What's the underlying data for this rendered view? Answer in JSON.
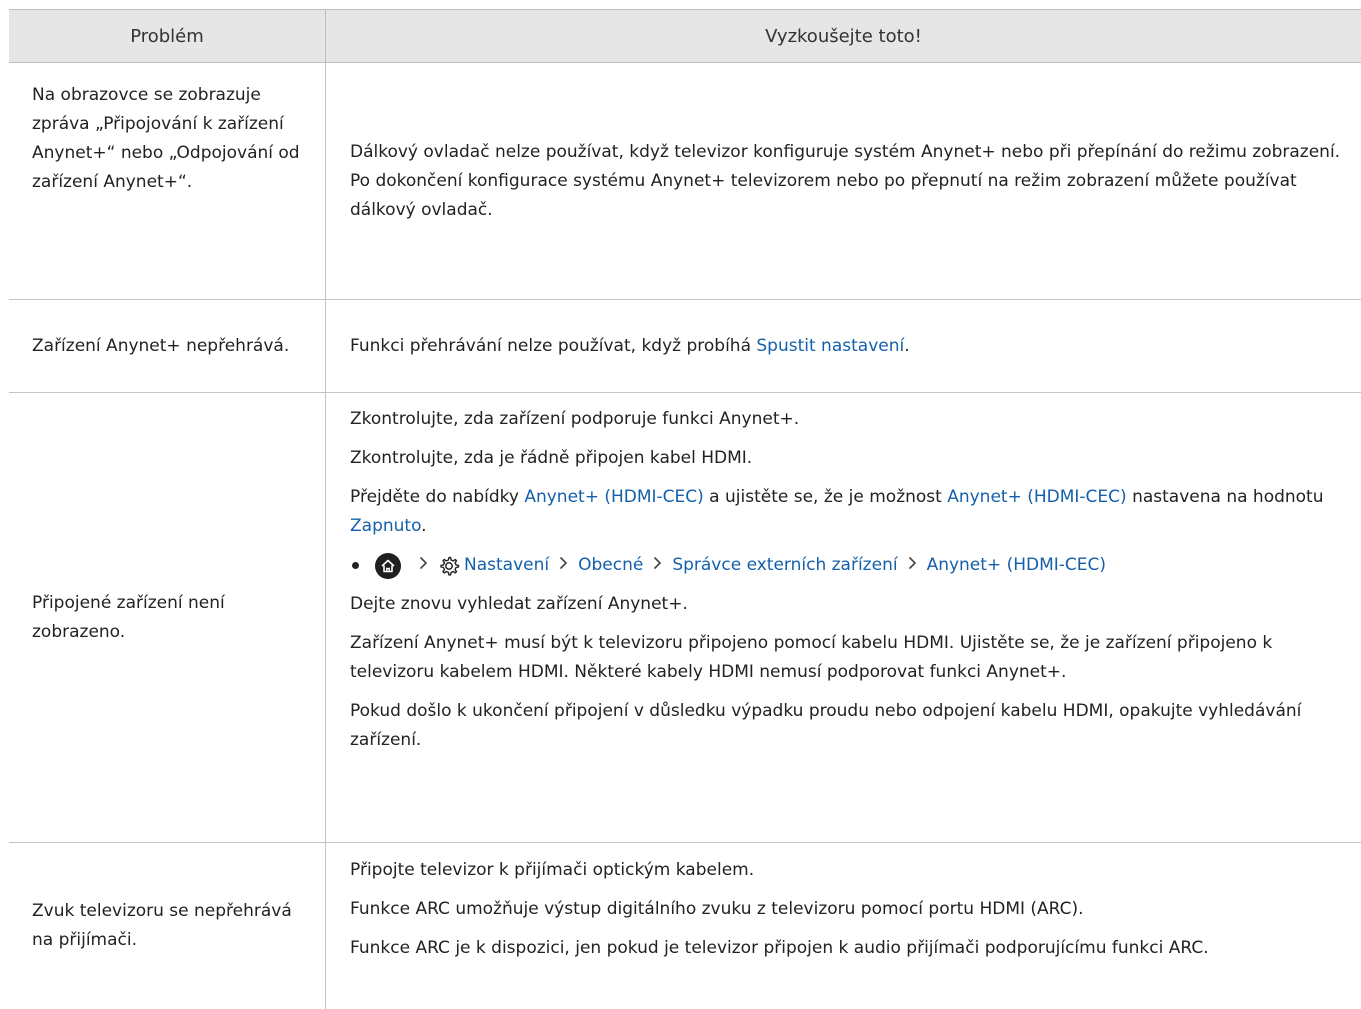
{
  "header": {
    "col_problem": "Problém",
    "col_solution": "Vyzkoušejte toto!"
  },
  "rows": [
    {
      "problem": "Na obrazovce se zobrazuje zpráva „Připojování k zařízení Anynet+“ nebo „Odpojování od zařízení Anynet+“.",
      "solution": "Dálkový ovladač nelze používat, když televizor konfiguruje systém Anynet+ nebo při přepínání do režimu zobrazení. Po dokončení konfigurace systému Anynet+ televizorem nebo po přepnutí na režim zobrazení můžete používat dálkový ovladač."
    },
    {
      "problem": "Zařízení Anynet+ nepřehrává.",
      "solution_pre": "Funkci přehrávání nelze používat, když probíhá ",
      "solution_link": "Spustit nastavení",
      "solution_post": "."
    },
    {
      "problem": "Připojené zařízení není zobrazeno.",
      "p1": "Zkontrolujte, zda zařízení podporuje funkci Anynet+.",
      "p2": "Zkontrolujte, zda je řádně připojen kabel HDMI.",
      "p3_a": "Přejděte do nabídky ",
      "p3_link1": "Anynet+ (HDMI-CEC)",
      "p3_b": " a ujistěte se, že je možnost ",
      "p3_link2": "Anynet+ (HDMI-CEC)",
      "p3_c": " nastavena na hodnotu ",
      "p3_link3": "Zapnuto",
      "p3_d": ".",
      "path": [
        "Nastavení",
        "Obecné",
        "Správce externích zařízení",
        "Anynet+ (HDMI-CEC)"
      ],
      "p4": "Dejte znovu vyhledat zařízení Anynet+.",
      "p5": "Zařízení Anynet+ musí být k televizoru připojeno pomocí kabelu HDMI. Ujistěte se, že je zařízení připojeno k televizoru kabelem HDMI. Některé kabely HDMI nemusí podporovat funkci Anynet+.",
      "p6": "Pokud došlo k ukončení připojení v důsledku výpadku proudu nebo odpojení kabelu HDMI, opakujte vyhledávání zařízení."
    },
    {
      "problem": "Zvuk televizoru se nepřehrává na přijímači.",
      "p1": "Připojte televizor k přijímači optickým kabelem.",
      "p2": "Funkce ARC umožňuje výstup digitálního zvuku z televizoru pomocí portu HDMI (ARC).",
      "p3": "Funkce ARC je k dispozici, jen pokud je televizor připojen k audio přijímači podporujícímu funkci ARC."
    }
  ],
  "colors": {
    "link": "#1460aa",
    "header_bg": "#e6e6e6",
    "text": "#222222"
  },
  "icons": [
    "home-icon",
    "gear-icon",
    "chevron-right-icon"
  ]
}
